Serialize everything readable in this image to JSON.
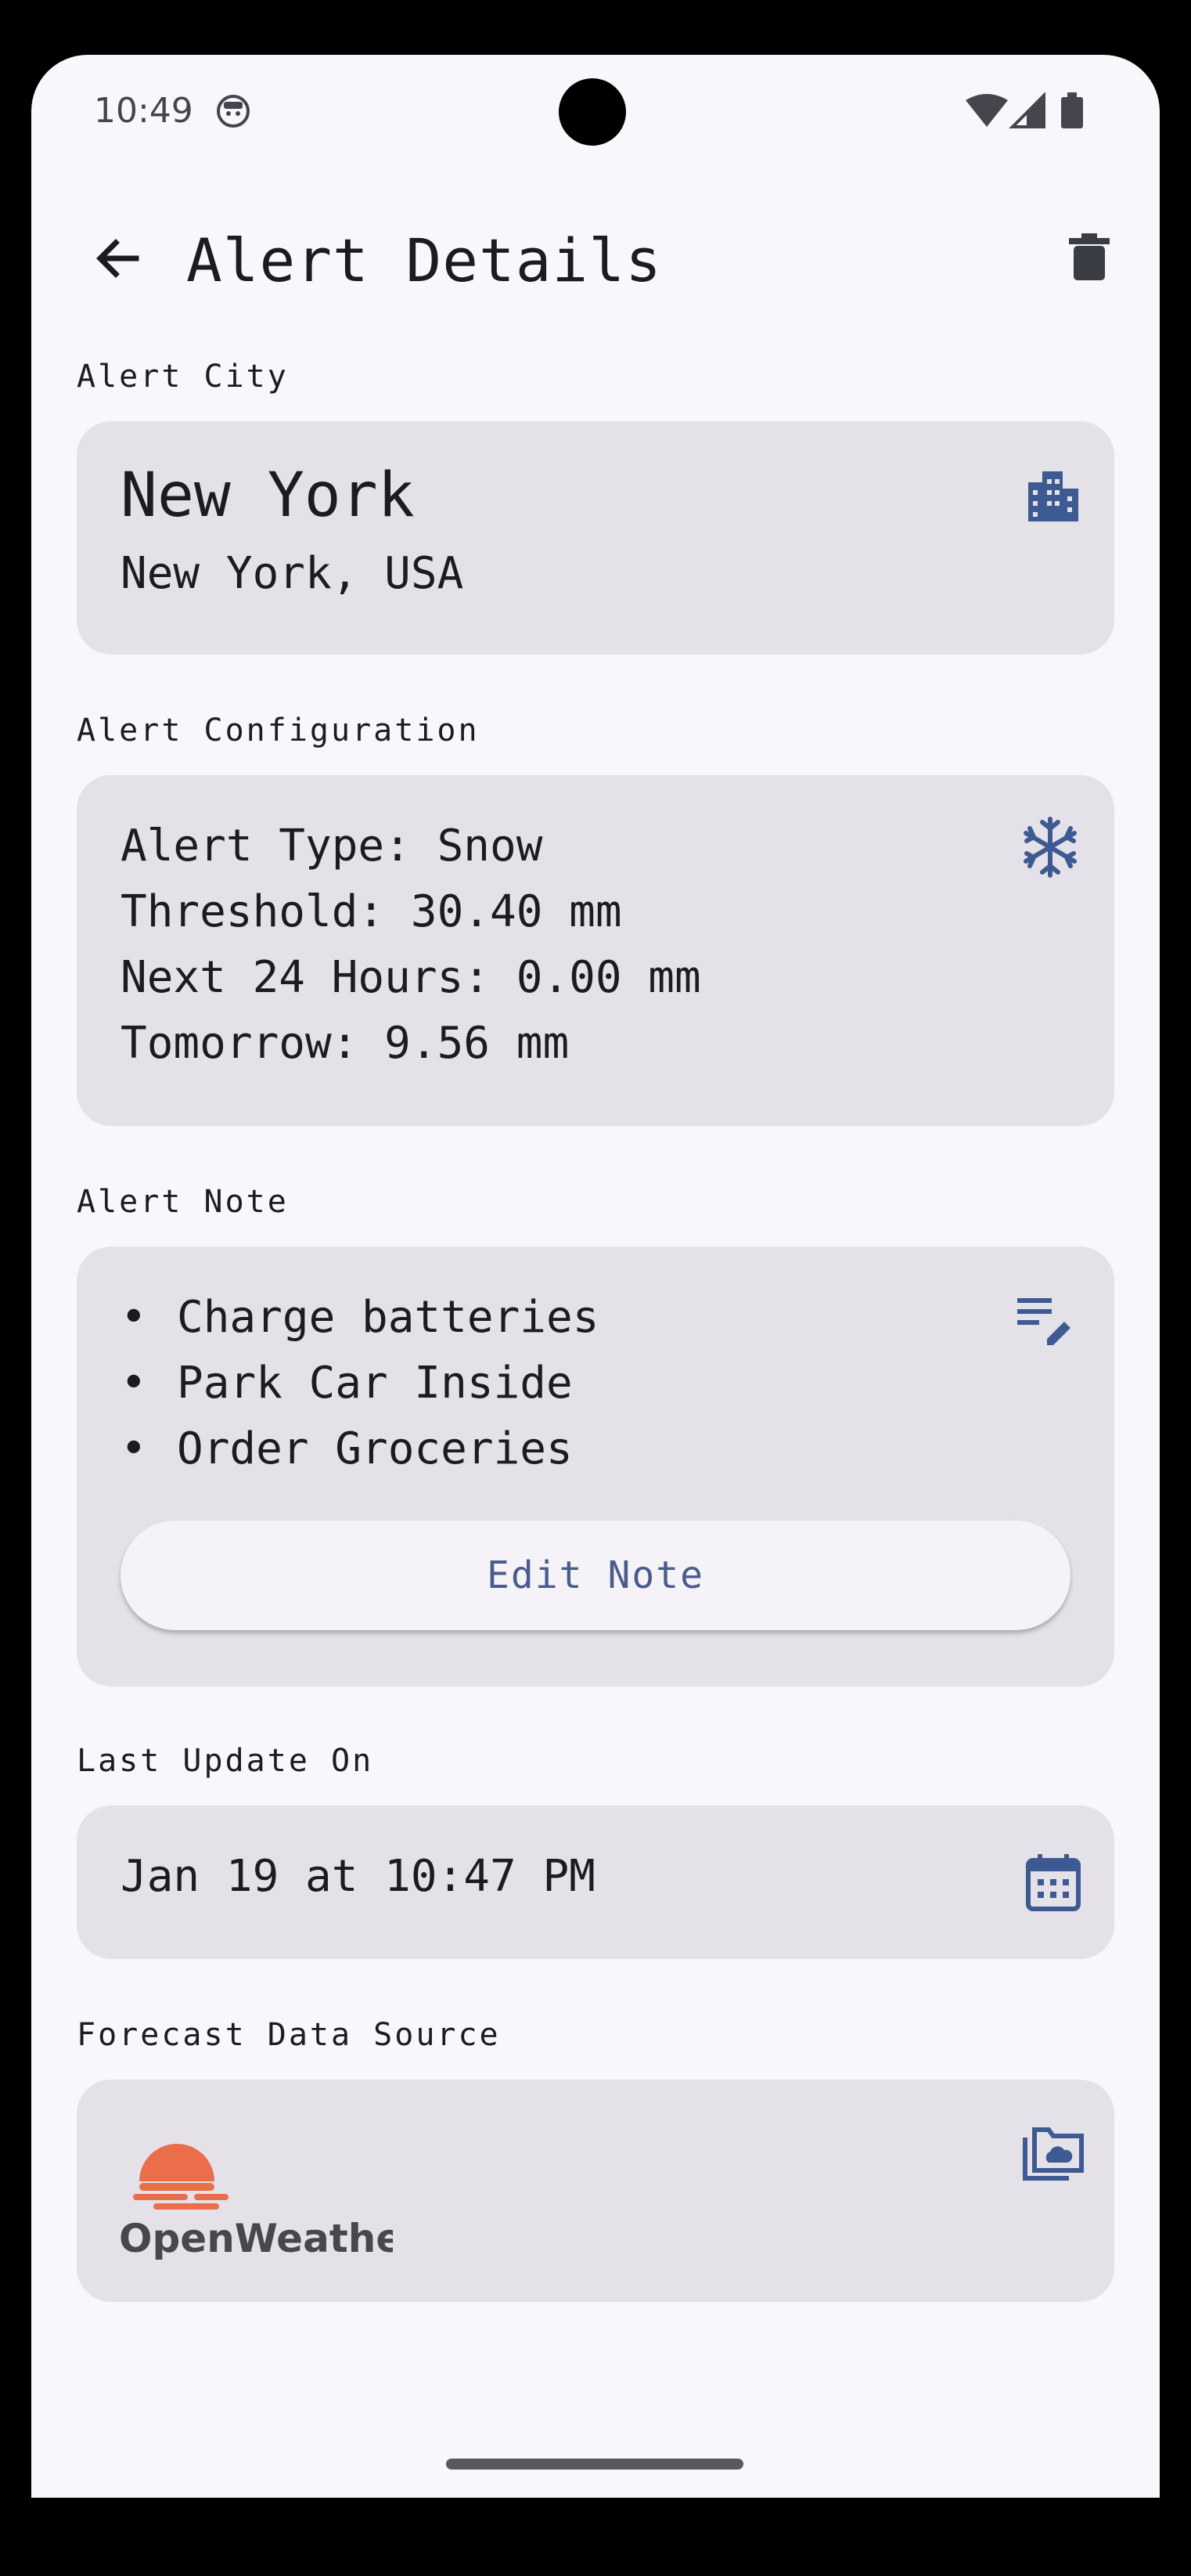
{
  "status_bar": {
    "time": "10:49"
  },
  "app_bar": {
    "title": "Alert Details"
  },
  "sections": {
    "city_label": "Alert City",
    "config_label": "Alert Configuration",
    "note_label": "Alert Note",
    "update_label": "Last Update On",
    "source_label": "Forecast Data Source"
  },
  "city": {
    "name": "New York",
    "region": "New York, USA"
  },
  "config": {
    "alert_type": "Alert Type: Snow",
    "threshold": "Threshold: 30.40 mm",
    "next_24": "Next 24 Hours: 0.00 mm",
    "tomorrow": "Tomorrow: 9.56 mm"
  },
  "note": {
    "bullet": "•",
    "items": [
      "Charge batteries",
      "Park Car Inside",
      "Order Groceries"
    ],
    "edit_label": "Edit Note"
  },
  "last_update": {
    "value": "Jan 19 at 10:47 PM"
  },
  "source": {
    "logo_text": "OpenWeather"
  },
  "colors": {
    "accent": "#4a5c8c",
    "card": "#e4e2e8",
    "background": "#f8f7fc",
    "openweather_orange": "#eb6e4b"
  },
  "icons": [
    "back-arrow-icon",
    "delete-icon",
    "city-building-icon",
    "snowflake-icon",
    "edit-note-icon",
    "calendar-icon",
    "cloud-folder-icon"
  ]
}
